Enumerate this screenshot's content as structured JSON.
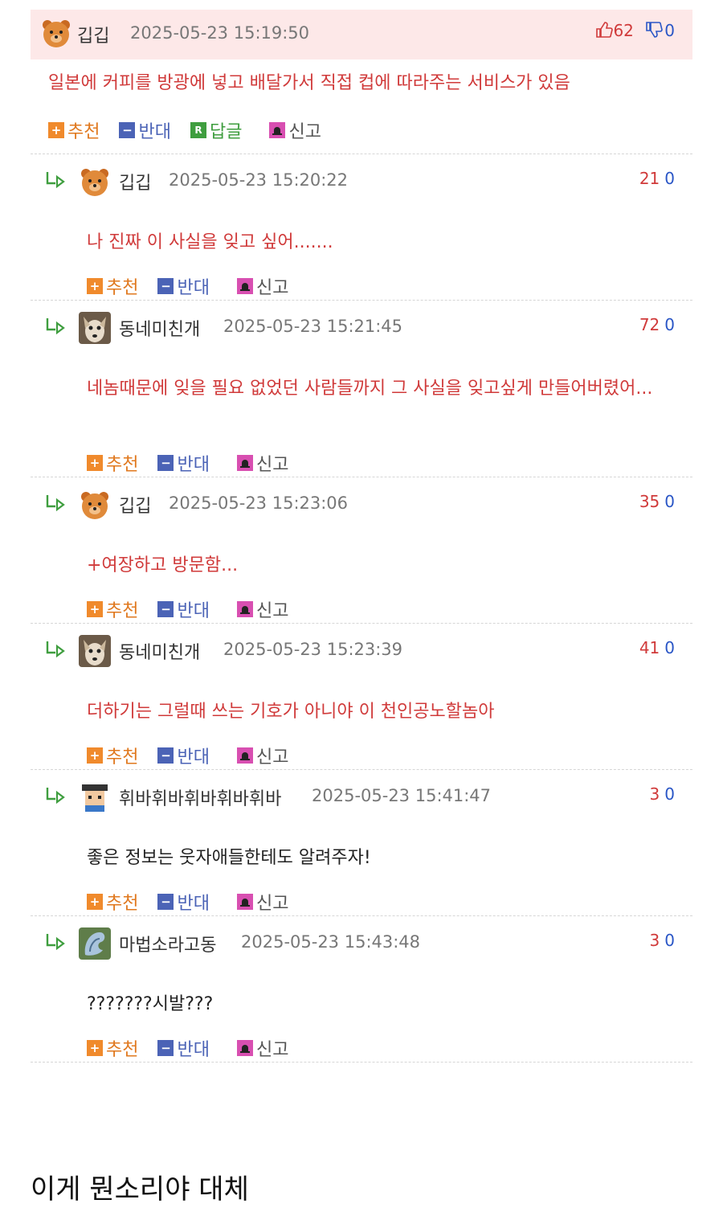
{
  "comments": [
    {
      "name": "깁깁",
      "date": "2025-05-23 15:19:50",
      "up": "62",
      "down": "0",
      "text": "일본에 커피를 방광에 넣고 배달가서 직접 컵에 따라주는 서비스가 있음",
      "avatar": "bear-avatar"
    },
    {
      "name": "깁깁",
      "date": "2025-05-23 15:20:22",
      "up": "21",
      "down": "0",
      "text": "나 진짜 이 사실을 잊고 싶어.......",
      "avatar": "bear-avatar"
    },
    {
      "name": "동네미친개",
      "date": "2025-05-23 15:21:45",
      "up": "72",
      "down": "0",
      "text": "네놈때문에 잊을 필요 없었던 사람들까지 그 사실을 잊고싶게 만들어버렸어...",
      "avatar": "dog-avatar"
    },
    {
      "name": "깁깁",
      "date": "2025-05-23 15:23:06",
      "up": "35",
      "down": "0",
      "text": "+여장하고 방문함...",
      "avatar": "bear-avatar"
    },
    {
      "name": "동네미친개",
      "date": "2025-05-23 15:23:39",
      "up": "41",
      "down": "0",
      "text": "더하기는 그럴때 쓰는 기호가 아니야 이 천인공노할놈아",
      "avatar": "dog-avatar"
    },
    {
      "name": "휘바휘바휘바휘바휘바",
      "date": "2025-05-23 15:41:47",
      "up": "3",
      "down": "0",
      "text": "좋은 정보는 웃자애들한테도 알려주자!",
      "avatar": "pixel-avatar"
    },
    {
      "name": "마법소라고동",
      "date": "2025-05-23 15:43:48",
      "up": "3",
      "down": "0",
      "text": "???????시발???",
      "avatar": "shell-avatar"
    }
  ],
  "actions": {
    "recommend": "추천",
    "oppose": "반대",
    "reply": "답글",
    "report": "신고",
    "reply_icon_letter": "R"
  },
  "caption": "이게 뭔소리야 대체",
  "colors": {
    "highlight_bg": "#fde8e8",
    "red_text": "#d03a3a",
    "blue": "#2a56c6",
    "recommend": "#f08a2c",
    "oppose": "#4b63b6",
    "reply": "#3f9e3f",
    "report": "#d84fb1"
  }
}
